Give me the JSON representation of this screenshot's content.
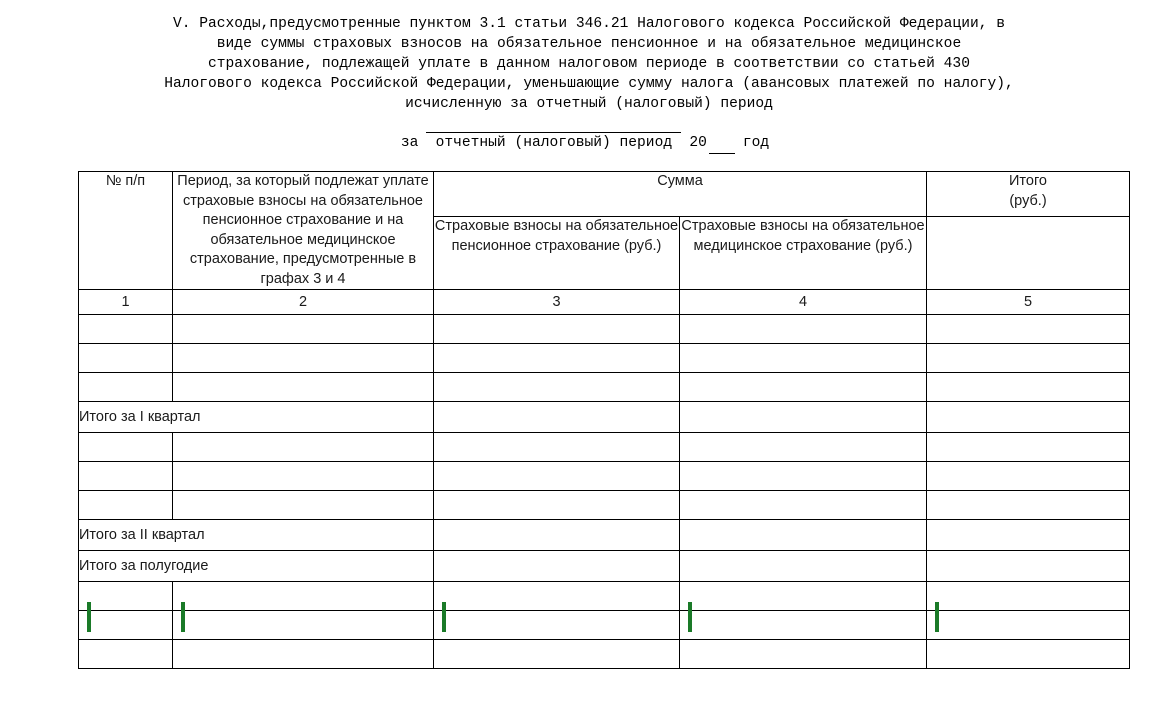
{
  "document": {
    "heading_lines": [
      "V. Расходы,предусмотренные пунктом 3.1 статьи 346.21 Налогового кодекса Российской Федерации, в",
      "виде суммы страховых взносов на обязательное пенсионное и на обязательное медицинское",
      "страхование, подлежащей уплате в данном налоговом периоде в соответствии со статьей 430",
      "Налогового кодекса Российской Федерации, уменьшающие сумму налога (авансовых платежей по налогу),",
      "исчисленную за отчетный (налоговый) период"
    ],
    "period_line": {
      "za_label": "за",
      "blank_value": "",
      "year_prefix": "20",
      "year_value": "",
      "year_suffix": "год",
      "caption": "отчетный (налоговый) период"
    }
  },
  "table": {
    "headers": {
      "col1": "№ п/п",
      "col2": "Период, за который подлежат уплате страховые взносы на обязательное пенсионное страхование и на обязательное медицинское страхование, предусмотренные в графах 3 и 4",
      "summa_group": "Сумма",
      "col3": "Страховые взносы на обязательное пенсионное страхование (руб.)",
      "col4": "Страховые взносы на обязательное медицинское страхование (руб.)",
      "col5": "Итого\n(руб.)",
      "col5_line1": "Итого",
      "col5_line2": "(руб.)"
    },
    "column_numbers": [
      "1",
      "2",
      "3",
      "4",
      "5"
    ],
    "rows": [
      {
        "type": "data",
        "label": "",
        "col1": "",
        "col2": "",
        "col3": "",
        "col4": "",
        "col5": ""
      },
      {
        "type": "data",
        "label": "",
        "col1": "",
        "col2": "",
        "col3": "",
        "col4": "",
        "col5": ""
      },
      {
        "type": "data",
        "label": "",
        "col1": "",
        "col2": "",
        "col3": "",
        "col4": "",
        "col5": ""
      },
      {
        "type": "total",
        "label": "Итого за I квартал",
        "col3": "",
        "col4": "",
        "col5": ""
      },
      {
        "type": "data",
        "label": "",
        "col1": "",
        "col2": "",
        "col3": "",
        "col4": "",
        "col5": ""
      },
      {
        "type": "data",
        "label": "",
        "col1": "",
        "col2": "",
        "col3": "",
        "col4": "",
        "col5": ""
      },
      {
        "type": "data",
        "label": "",
        "col1": "",
        "col2": "",
        "col3": "",
        "col4": "",
        "col5": ""
      },
      {
        "type": "total",
        "label": "Итого за II квартал",
        "col3": "",
        "col4": "",
        "col5": ""
      },
      {
        "type": "total",
        "label": "Итого за полугодие",
        "col3": "",
        "col4": "",
        "col5": ""
      },
      {
        "type": "data",
        "label": "",
        "col1": "",
        "col2": "",
        "col3": "",
        "col4": "",
        "col5": ""
      },
      {
        "type": "cursor",
        "label": "",
        "col1": "",
        "col2": "",
        "col3": "",
        "col4": "",
        "col5": ""
      },
      {
        "type": "data",
        "label": "",
        "col1": "",
        "col2": "",
        "col3": "",
        "col4": "",
        "col5": ""
      }
    ]
  },
  "colors": {
    "caret": "#1a7a28",
    "border": "#000000",
    "text": "#1a1a1a",
    "background": "#ffffff"
  }
}
